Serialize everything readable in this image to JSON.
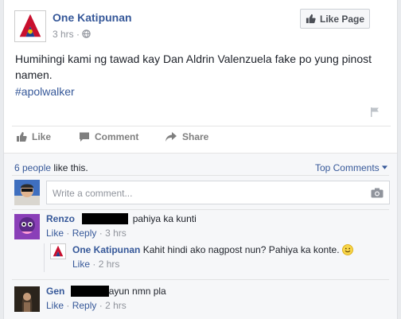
{
  "post": {
    "page_name": "One Katipunan",
    "time": "3 hrs",
    "like_page_label": "Like Page",
    "text": "Humihingi kami ng tawad kay Dan Aldrin Valenzuela fake po yung pinost namen.",
    "hashtag": "#apolwalker"
  },
  "actions": {
    "like": "Like",
    "comment": "Comment",
    "share": "Share"
  },
  "ufi": {
    "likes_link": "6 people",
    "likes_suffix": " like this.",
    "top_comments": "Top Comments",
    "write_placeholder": "Write a comment..."
  },
  "comments": [
    {
      "name": "Renzo",
      "text": "pahiya ka kunti",
      "like": "Like",
      "reply": "Reply",
      "time": "3 hrs"
    },
    {
      "name": "One Katipunan",
      "text": "Kahit hindi ako nagpost nun? Pahiya ka konte.",
      "like": "Like",
      "time": "2 hrs"
    },
    {
      "name": "Gen",
      "text": "ayun nmn pla",
      "like": "Like",
      "reply": "Reply",
      "time": "2 hrs"
    }
  ],
  "colors": {
    "link": "#365899",
    "muted": "#90949c",
    "background": "#f6f7f9"
  }
}
